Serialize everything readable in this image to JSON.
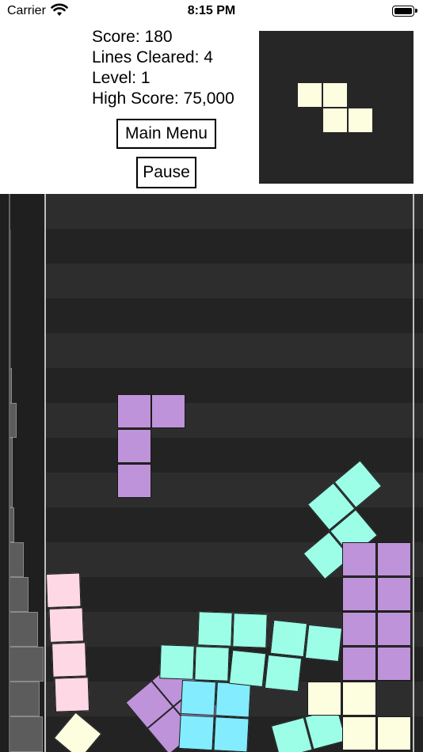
{
  "status_bar": {
    "carrier": "Carrier",
    "time": "8:15 PM",
    "wifi_icon": "wifi-icon",
    "battery_icon": "battery-icon"
  },
  "stats": {
    "score": "Score: 180",
    "lines_cleared": "Lines Cleared: 4",
    "level": "Level: 1",
    "high_score": "High Score: 75,000"
  },
  "buttons": {
    "main_menu": "Main Menu",
    "pause": "Pause"
  },
  "colors": {
    "yellow": "#fdfde0",
    "purple": "#be93d9",
    "mint": "#9cfee7",
    "cyan": "#83ecff",
    "pink": "#ffd8e6",
    "board_bg": "#222222"
  },
  "next_piece": {
    "type": "Z",
    "color": "yellow"
  },
  "board": {
    "falling_piece": {
      "type": "J",
      "color": "purple"
    },
    "settled_pieces": [
      {
        "type": "I",
        "color": "pink"
      },
      {
        "type": "S",
        "color": "purple"
      },
      {
        "type": "O",
        "color": "cyan"
      },
      {
        "type": "T",
        "color": "mint"
      },
      {
        "type": "S",
        "color": "mint"
      },
      {
        "type": "Z",
        "color": "mint"
      },
      {
        "type": "S",
        "color": "mint"
      },
      {
        "type": "O",
        "color": "purple"
      },
      {
        "type": "O",
        "color": "purple"
      },
      {
        "type": "O",
        "color": "yellow"
      },
      {
        "type": "O",
        "color": "yellow"
      },
      {
        "type": "S",
        "color": "mint"
      },
      {
        "type": "single",
        "color": "yellow"
      }
    ]
  }
}
